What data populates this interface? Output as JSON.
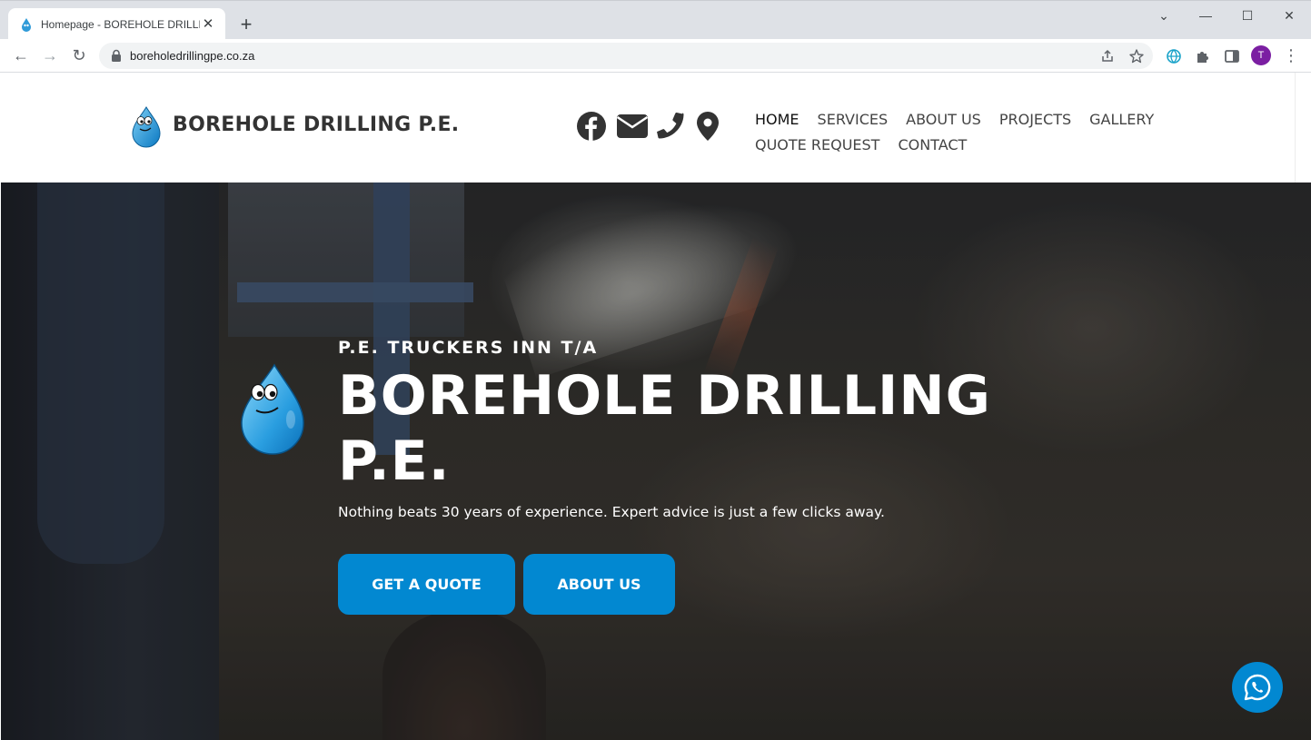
{
  "browser": {
    "tab": {
      "title": "Homepage - BOREHOLE DRILLING P.E.",
      "close_glyph": "✕"
    },
    "new_tab_glyph": "+",
    "window_controls": {
      "minimize": "—",
      "maximize": "☐",
      "close": "✕",
      "menu": "⌄"
    },
    "nav": {
      "back": "←",
      "forward": "→",
      "reload": "↻"
    },
    "url": "boreholedrillingpe.co.za",
    "profile_initial": "T",
    "menu_glyph": "⋮"
  },
  "site": {
    "logo_text": "BOREHOLE DRILLING P.E.",
    "social_icons": [
      "facebook-icon",
      "email-icon",
      "phone-icon",
      "map-pin-icon"
    ],
    "nav": {
      "row1": [
        "HOME",
        "SERVICES",
        "ABOUT US",
        "PROJECTS",
        "GALLERY"
      ],
      "row2": [
        "QUOTE REQUEST",
        "CONTACT"
      ],
      "active": "HOME"
    },
    "colors": {
      "accent": "#0288d1",
      "header_text": "#333333"
    }
  },
  "hero": {
    "eyebrow": "P.E. TRUCKERS INN T/A",
    "title": "BOREHOLE DRILLING P.E.",
    "subtitle": "Nothing beats 30 years of experience. Expert advice is just a few clicks away.",
    "buttons": {
      "quote": "GET A QUOTE",
      "about": "ABOUT US"
    }
  },
  "chat_widget": {
    "icon": "whatsapp-icon"
  }
}
